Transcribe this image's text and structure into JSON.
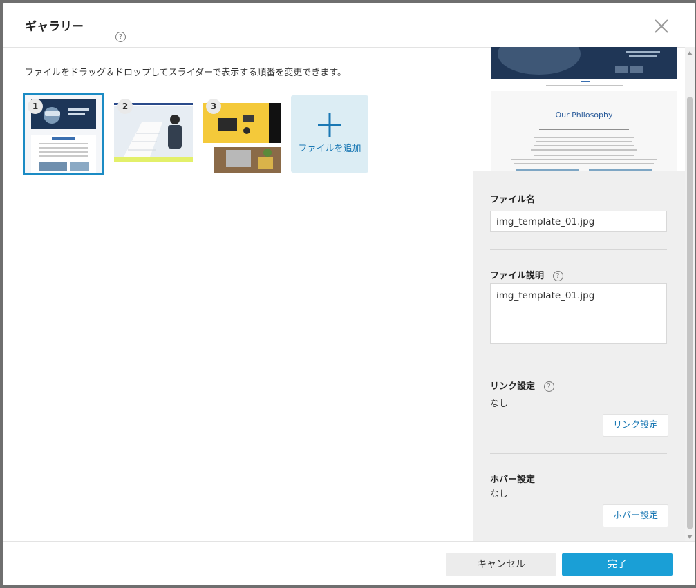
{
  "dialog": {
    "title": "ギャラリー",
    "help_icon": "question-circle-icon",
    "close_icon": "close-icon"
  },
  "gallery": {
    "instruction": "ファイルをドラッグ＆ドロップしてスライダーで表示する順番を変更できます。",
    "items": [
      {
        "number": "1",
        "selected": true
      },
      {
        "number": "2",
        "selected": false
      },
      {
        "number": "3",
        "selected": false
      }
    ],
    "add_label": "ファイルを追加",
    "add_icon": "plus-icon"
  },
  "preview": {
    "heading": "Our Philosophy"
  },
  "settings": {
    "file_name_label": "ファイル名",
    "file_name_value": "img_template_01.jpg",
    "description_label": "ファイル説明",
    "description_value": "img_template_01.jpg",
    "link_label": "リンク設定",
    "link_value": "なし",
    "link_button": "リンク設定",
    "hover_label": "ホバー設定",
    "hover_value": "なし",
    "hover_button": "ホバー設定"
  },
  "footer": {
    "cancel": "キャンセル",
    "done": "完了"
  },
  "colors": {
    "accent": "#1a9fd6",
    "link": "#1a78b4",
    "selected_outline": "#1b8bc4",
    "add_tile_bg": "#dcedf4"
  }
}
